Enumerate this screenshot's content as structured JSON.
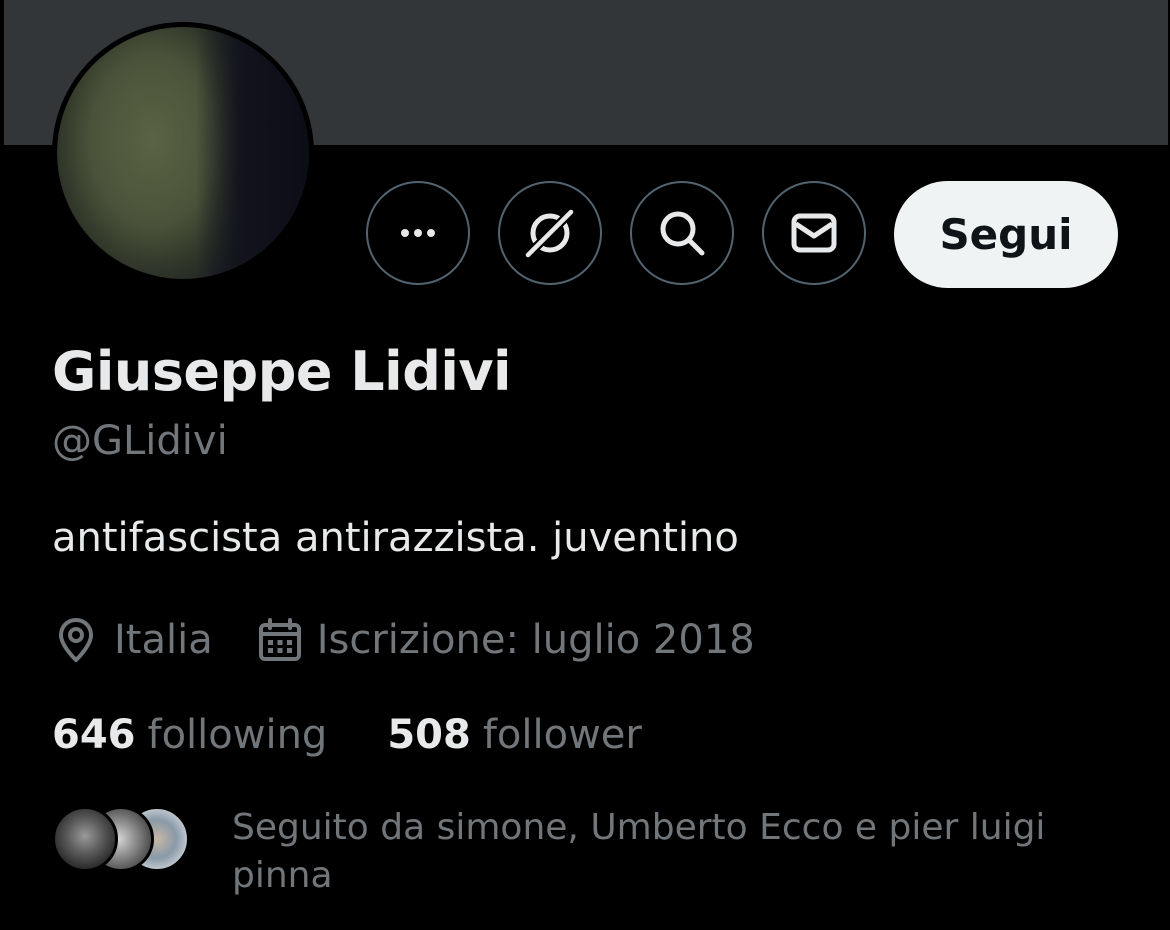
{
  "profile": {
    "name": "Giuseppe Lidivi",
    "handle": "@GLidivi",
    "bio": "antifascista antirazzista. juventino",
    "location": "Italia",
    "joined": "Iscrizione: luglio 2018"
  },
  "actions": {
    "more_icon": "more-horizontal-icon",
    "grok_icon": "grok-icon",
    "search_icon": "search-icon",
    "message_icon": "envelope-icon",
    "follow_label": "Segui"
  },
  "stats": {
    "following_count": "646",
    "following_label": "following",
    "followers_count": "508",
    "followers_label": "follower"
  },
  "followed_by": {
    "text": "Seguito da simone, Umberto Ecco e pier luigi pinna"
  },
  "colors": {
    "background": "#000000",
    "banner": "#333639",
    "primary_text": "#e7e9ea",
    "secondary_text": "#71767b",
    "button_border": "#536471",
    "follow_button_bg": "#eff3f4"
  }
}
